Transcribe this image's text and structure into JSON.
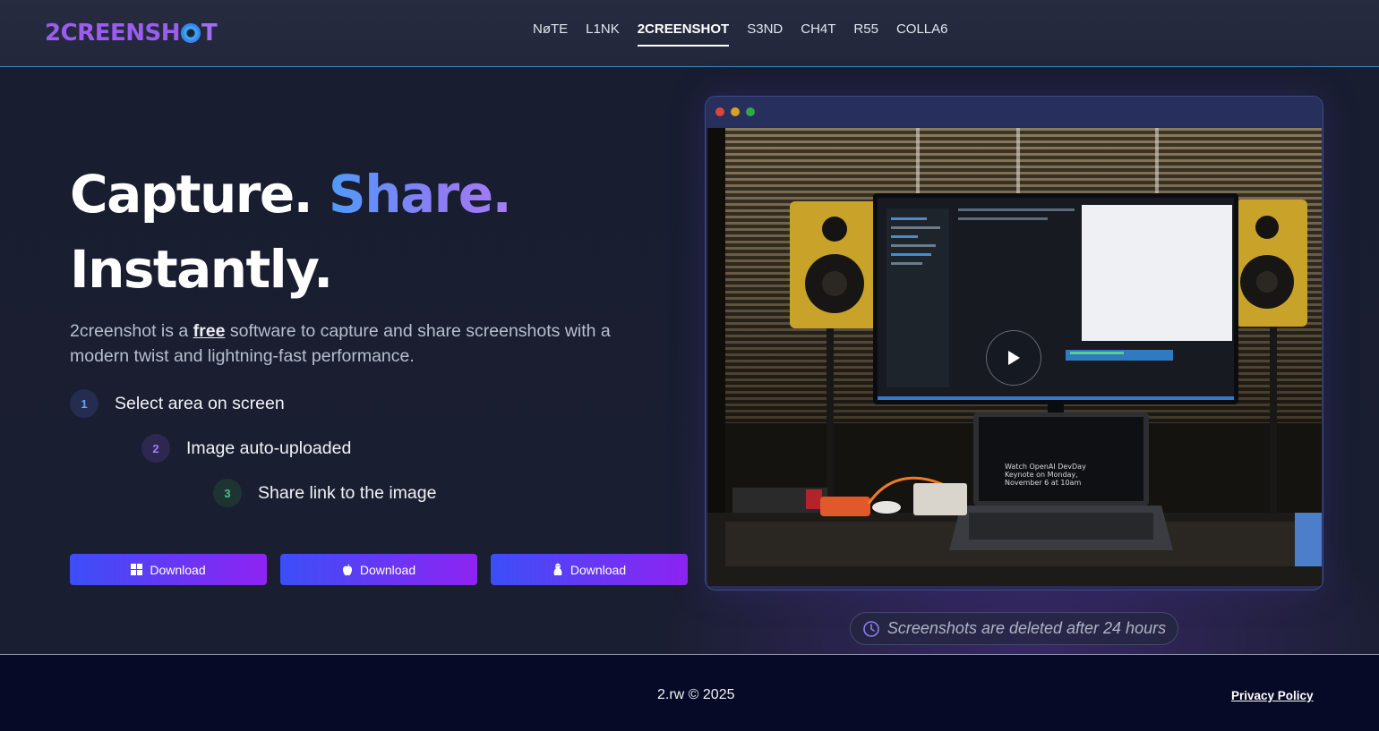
{
  "brand": {
    "logo_prefix": "2CREENSH",
    "logo_suffix": "T"
  },
  "nav": {
    "items": [
      {
        "label": "NøTE"
      },
      {
        "label": "L1NK"
      },
      {
        "label": "2CREENSHOT",
        "active": true
      },
      {
        "label": "S3ND"
      },
      {
        "label": "CH4T"
      },
      {
        "label": "R55"
      },
      {
        "label": "COLLA6"
      }
    ]
  },
  "hero": {
    "headline_part1": "Capture.",
    "headline_accent": "Share.",
    "headline_part2": "Instantly.",
    "lead_before": "2creenshot is a ",
    "lead_free": "free",
    "lead_after": " software to capture and share screenshots with a modern twist and lightning-fast performance.",
    "steps": [
      {
        "num": "1",
        "label": "Select area on screen"
      },
      {
        "num": "2",
        "label": "Image auto-uploaded"
      },
      {
        "num": "3",
        "label": "Share link to the image"
      }
    ],
    "downloads": [
      {
        "label": "Download",
        "icon": "windows-icon"
      },
      {
        "label": "Download",
        "icon": "apple-icon"
      },
      {
        "label": "Download",
        "icon": "linux-icon"
      }
    ]
  },
  "preview": {
    "laptop_text": "Watch OpenAI DevDay Keynote on Monday, November 6 at 10am"
  },
  "notice": {
    "text": "Screenshots are deleted after 24 hours"
  },
  "footer": {
    "copyright": "2.rw © 2025",
    "privacy": "Privacy Policy"
  },
  "colors": {
    "brand_purple": "#9b5cf0",
    "accent_blue": "#4f9bf8",
    "button_gradient_start": "#3b4ef7",
    "button_gradient_end": "#8f23f2"
  }
}
